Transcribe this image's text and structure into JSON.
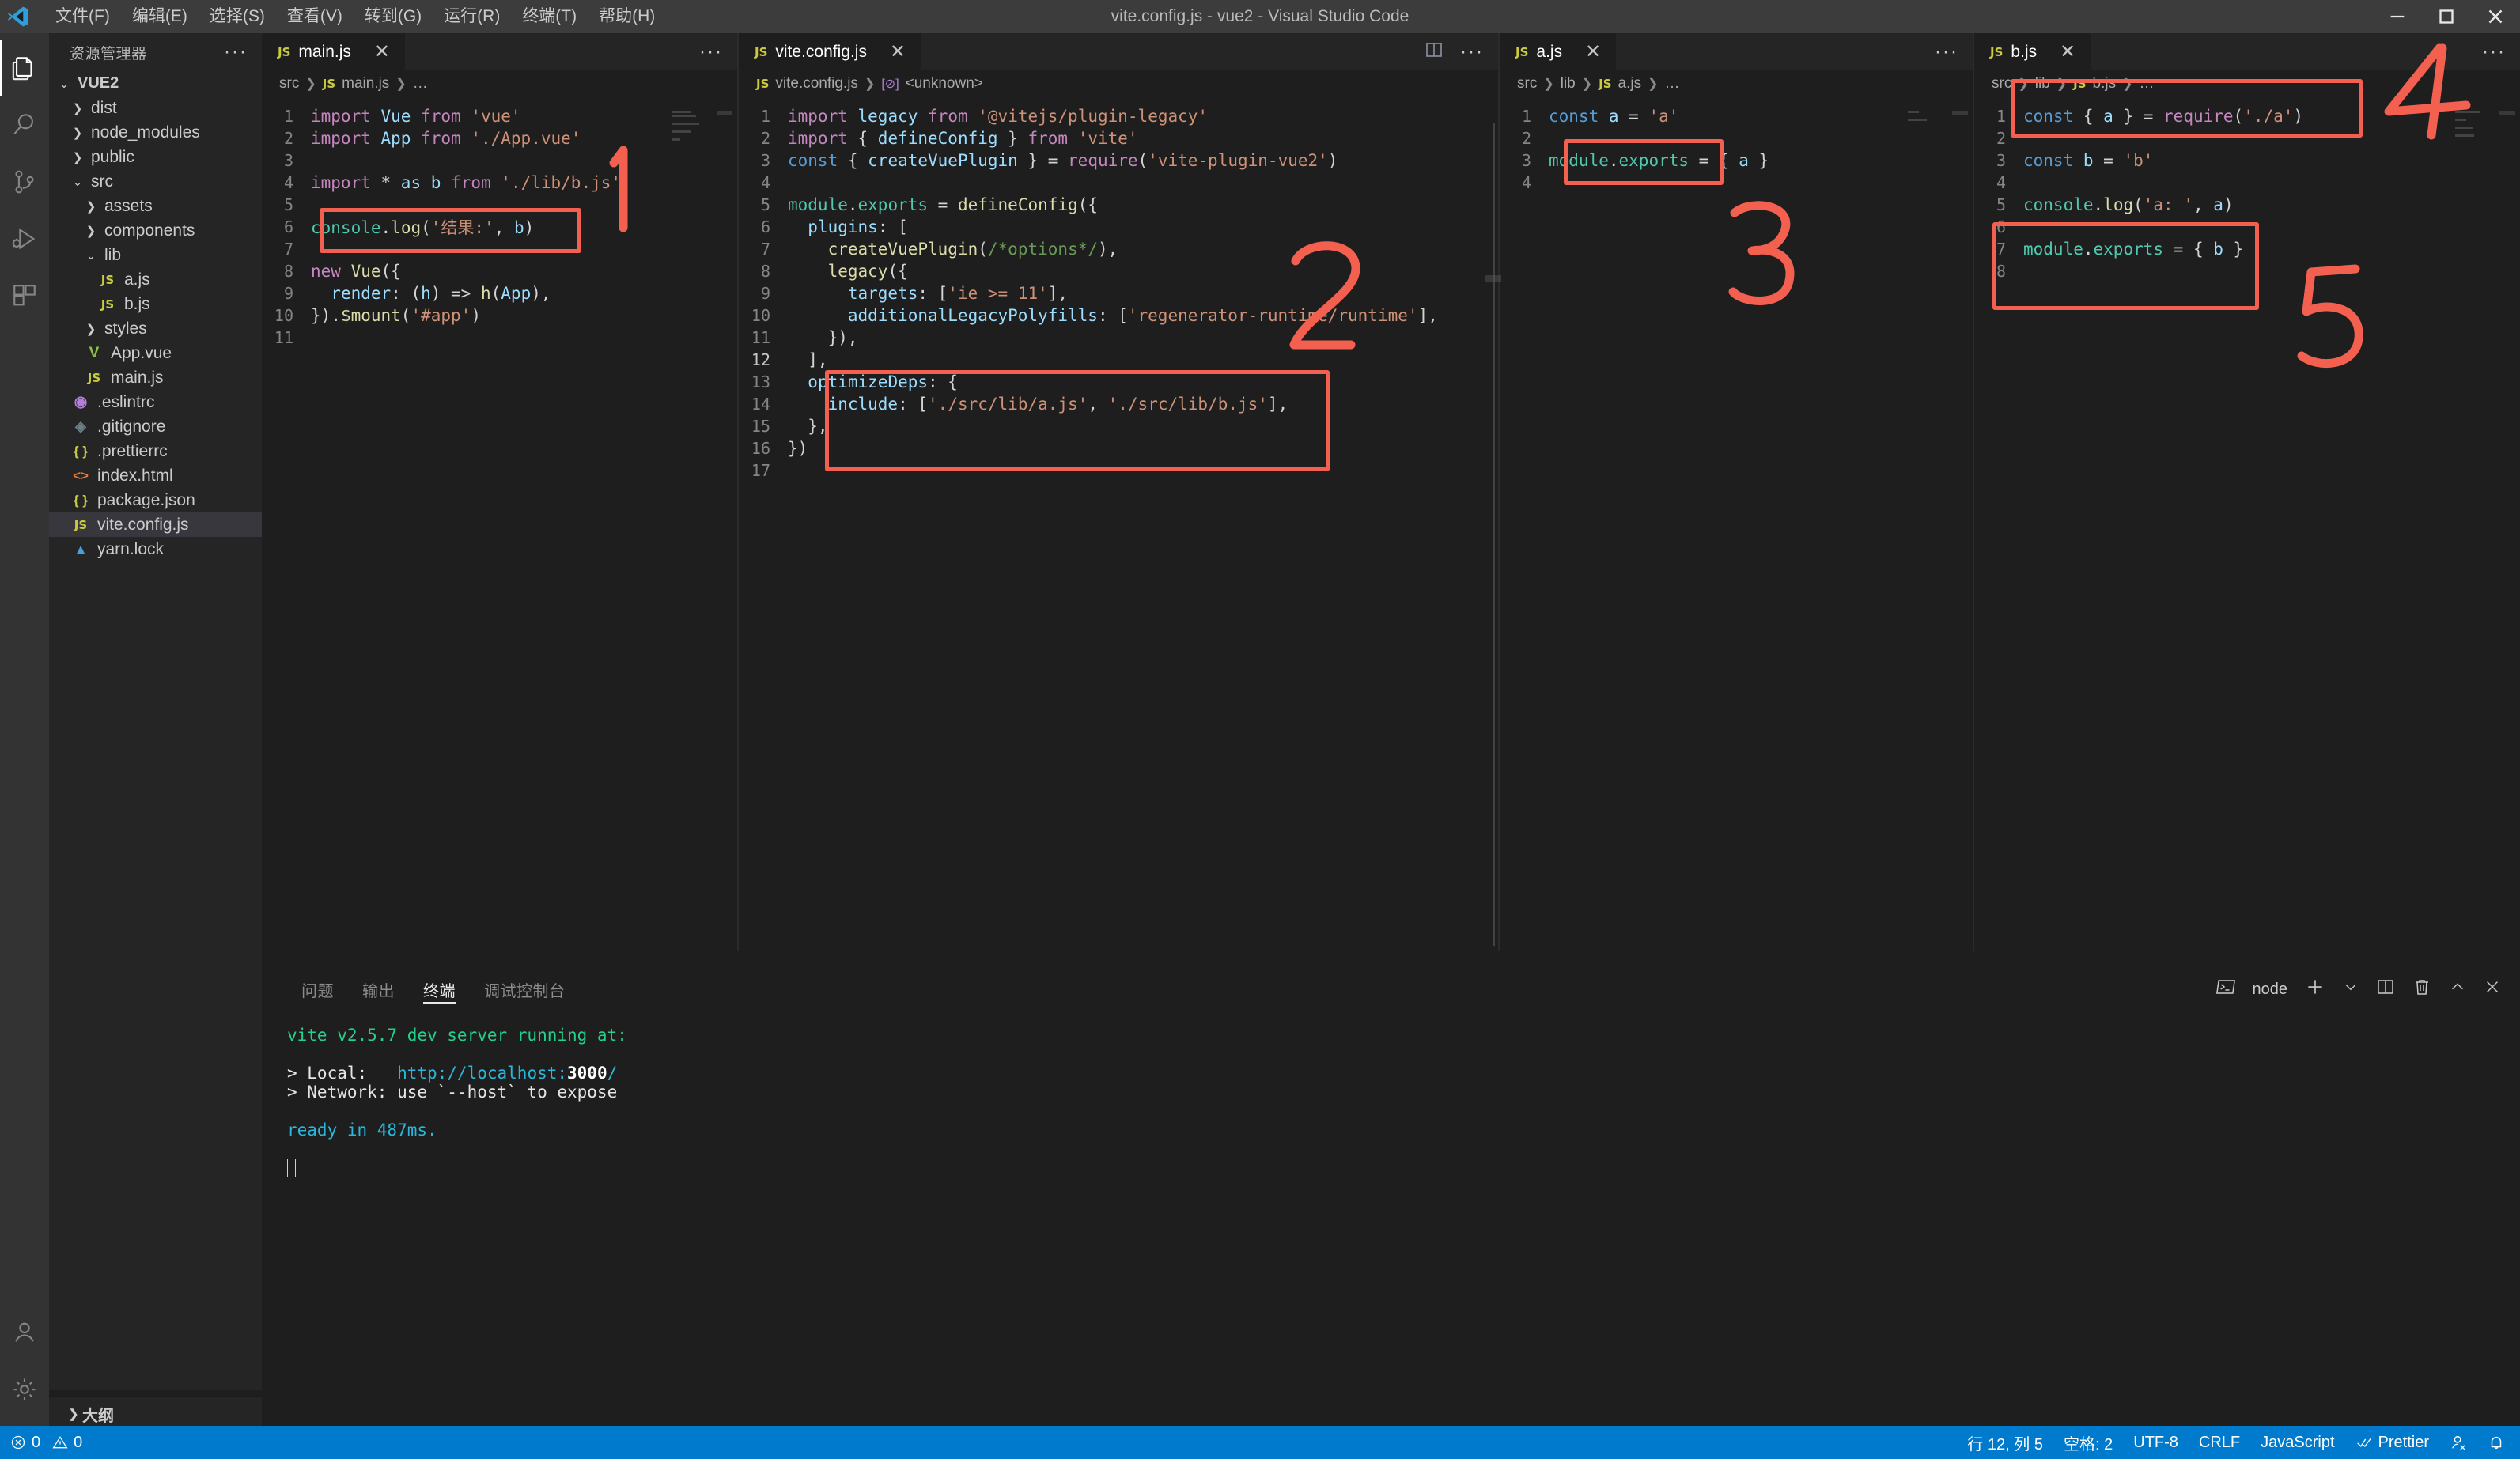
{
  "window": {
    "title": "vite.config.js - vue2 - Visual Studio Code",
    "menu": [
      "文件(F)",
      "编辑(E)",
      "选择(S)",
      "查看(V)",
      "转到(G)",
      "运行(R)",
      "终端(T)",
      "帮助(H)"
    ],
    "controls": {
      "minimize": "minimize-icon",
      "maximize": "maximize-icon",
      "close": "close-icon"
    }
  },
  "activitybar": {
    "items": [
      {
        "name": "explorer",
        "icon": "files-icon",
        "active": true
      },
      {
        "name": "search",
        "icon": "search-icon",
        "active": false
      },
      {
        "name": "source-control",
        "icon": "source-control-icon",
        "active": false
      },
      {
        "name": "run-and-debug",
        "icon": "debug-icon",
        "active": false
      },
      {
        "name": "extensions",
        "icon": "extensions-icon",
        "active": false
      }
    ],
    "bottom": [
      {
        "name": "accounts",
        "icon": "account-icon"
      },
      {
        "name": "manage",
        "icon": "gear-icon"
      }
    ]
  },
  "sidebar": {
    "title": "资源管理器",
    "more": "···",
    "outline_label": "大纲",
    "tree": [
      {
        "label": "VUE2",
        "depth": 0,
        "type": "root",
        "state": "expanded"
      },
      {
        "label": "dist",
        "depth": 1,
        "type": "folder",
        "state": "collapsed"
      },
      {
        "label": "node_modules",
        "depth": 1,
        "type": "folder",
        "state": "collapsed"
      },
      {
        "label": "public",
        "depth": 1,
        "type": "folder",
        "state": "collapsed"
      },
      {
        "label": "src",
        "depth": 1,
        "type": "folder",
        "state": "expanded"
      },
      {
        "label": "assets",
        "depth": 2,
        "type": "folder",
        "state": "collapsed"
      },
      {
        "label": "components",
        "depth": 2,
        "type": "folder",
        "state": "collapsed"
      },
      {
        "label": "lib",
        "depth": 2,
        "type": "folder",
        "state": "expanded"
      },
      {
        "label": "a.js",
        "depth": 3,
        "type": "js"
      },
      {
        "label": "b.js",
        "depth": 3,
        "type": "js"
      },
      {
        "label": "styles",
        "depth": 2,
        "type": "folder",
        "state": "collapsed"
      },
      {
        "label": "App.vue",
        "depth": 2,
        "type": "vue"
      },
      {
        "label": "main.js",
        "depth": 2,
        "type": "js"
      },
      {
        "label": ".eslintrc",
        "depth": 1,
        "type": "eslint"
      },
      {
        "label": ".gitignore",
        "depth": 1,
        "type": "git"
      },
      {
        "label": ".prettierrc",
        "depth": 1,
        "type": "json"
      },
      {
        "label": "index.html",
        "depth": 1,
        "type": "html"
      },
      {
        "label": "package.json",
        "depth": 1,
        "type": "json"
      },
      {
        "label": "vite.config.js",
        "depth": 1,
        "type": "js",
        "selected": true
      },
      {
        "label": "yarn.lock",
        "depth": 1,
        "type": "lock"
      }
    ]
  },
  "editors": [
    {
      "tab": "main.js",
      "active": false,
      "breadcrumb": [
        "src",
        "main.js",
        "…"
      ],
      "lines": [
        "import Vue from 'vue'",
        "import App from './App.vue'",
        "",
        "import * as b from './lib/b.js'",
        "",
        "console.log('结果:', b)",
        "",
        "new Vue({",
        "  render: (h) => h(App),",
        "}).$mount('#app')",
        ""
      ]
    },
    {
      "tab": "vite.config.js",
      "active": true,
      "breadcrumb": [
        "vite.config.js",
        "<unknown>"
      ],
      "lines": [
        "import legacy from '@vitejs/plugin-legacy'",
        "import { defineConfig } from 'vite'",
        "const { createVuePlugin } = require('vite-plugin-vue2')",
        "",
        "module.exports = defineConfig({",
        "  plugins: [",
        "    createVuePlugin(/*options*/),",
        "    legacy({",
        "      targets: ['ie >= 11'],",
        "      additionalLegacyPolyfills: ['regenerator-runtime/runtime'],",
        "    }),",
        "  ],",
        "  optimizeDeps: {",
        "    include: ['./src/lib/a.js', './src/lib/b.js'],",
        "  },",
        "})",
        ""
      ]
    },
    {
      "tab": "a.js",
      "active": false,
      "breadcrumb": [
        "src",
        "lib",
        "a.js",
        "…"
      ],
      "lines": [
        "const a = 'a'",
        "",
        "module.exports = { a }",
        ""
      ]
    },
    {
      "tab": "b.js",
      "active": false,
      "breadcrumb": [
        "src",
        "lib",
        "b.js",
        "…"
      ],
      "lines": [
        "const { a } = require('./a')",
        "",
        "const b = 'b'",
        "",
        "console.log('a: ', a)",
        "",
        "module.exports = { b }",
        ""
      ]
    }
  ],
  "panel": {
    "tabs": [
      "问题",
      "输出",
      "终端",
      "调试控制台"
    ],
    "active_tab": "终端",
    "shell_label": "node",
    "actions": [
      "new-terminal-icon",
      "chevron-down-icon",
      "split-terminal-icon",
      "trash-icon",
      "chevron-up-icon",
      "close-icon"
    ],
    "terminal_lines": [
      {
        "text": "vite v2.5.7 dev server running at:",
        "color": "green"
      },
      {
        "text": "",
        "color": "white"
      },
      {
        "text": "> Local:   http://localhost:3000/",
        "color": "mixed-local"
      },
      {
        "text": "> Network: use `--host` to expose",
        "color": "white"
      },
      {
        "text": "",
        "color": "white"
      },
      {
        "text": "ready in 487ms.",
        "color": "cyan"
      }
    ]
  },
  "statusbar": {
    "errors": "0",
    "warnings": "0",
    "position": "行 12, 列 5",
    "indent": "空格: 2",
    "encoding": "UTF-8",
    "eol": "CRLF",
    "language": "JavaScript",
    "formatter": "Prettier",
    "accent": "#007acc"
  },
  "annotations": {
    "color": "#f4604f",
    "numbers": [
      "1",
      "2",
      "3",
      "4",
      "5"
    ]
  }
}
